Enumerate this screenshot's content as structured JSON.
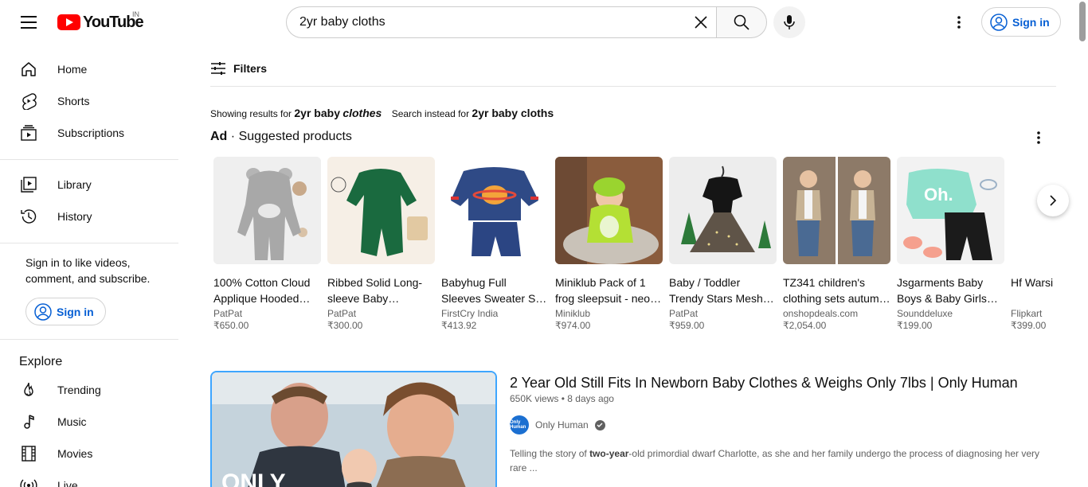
{
  "header": {
    "logo_text": "YouTube",
    "country": "IN",
    "search_value": "2yr baby cloths",
    "signin_label": "Sign in"
  },
  "sidebar": {
    "items": [
      {
        "label": "Home",
        "icon": "home-icon"
      },
      {
        "label": "Shorts",
        "icon": "shorts-icon"
      },
      {
        "label": "Subscriptions",
        "icon": "subscriptions-icon"
      },
      {
        "label": "Library",
        "icon": "library-icon"
      },
      {
        "label": "History",
        "icon": "history-icon"
      }
    ],
    "signin_prompt": "Sign in to like videos, comment, and subscribe.",
    "signin_label": "Sign in",
    "explore_title": "Explore",
    "explore_items": [
      {
        "label": "Trending",
        "icon": "trending-icon"
      },
      {
        "label": "Music",
        "icon": "music-icon"
      },
      {
        "label": "Movies",
        "icon": "movies-icon"
      },
      {
        "label": "Live",
        "icon": "live-icon"
      }
    ]
  },
  "main": {
    "filters_label": "Filters",
    "showing_prefix": "Showing results for",
    "showing_query_a": "2yr baby",
    "showing_query_b": "clothes",
    "instead_prefix": "Search instead for",
    "instead_query": "2yr baby cloths",
    "ad_label": "Ad",
    "ad_dot": "·",
    "ad_title": "Suggested products",
    "products": [
      {
        "name": "100% Cotton Cloud Applique Hooded…",
        "seller": "PatPat",
        "price": "₹650.00"
      },
      {
        "name": "Ribbed Solid Long-sleeve Baby…",
        "seller": "PatPat",
        "price": "₹300.00"
      },
      {
        "name": "Babyhug Full Sleeves Sweater Set Planet …",
        "seller": "FirstCry India",
        "price": "₹413.92"
      },
      {
        "name": "Miniklub Pack of 1 frog sleepsuit - neo…",
        "seller": "Miniklub",
        "price": "₹974.00"
      },
      {
        "name": "Baby / Toddler Trendy Stars Mesh…",
        "seller": "PatPat",
        "price": "₹959.00"
      },
      {
        "name": "TZ341 children's clothing sets autum…",
        "seller": "onshopdeals.com",
        "price": "₹2,054.00"
      },
      {
        "name": "Jsgarments Baby Boys & Baby Girls…",
        "seller": "Sounddeluxe",
        "price": "₹199.00"
      },
      {
        "name": "Hf Warsi Baby Girls",
        "seller": "Flipkart",
        "price": "₹399.00"
      }
    ],
    "video": {
      "title": "2 Year Old Still Fits In Newborn Baby Clothes & Weighs Only 7lbs | Only Human",
      "views": "650K views",
      "sep": "•",
      "age": "8 days ago",
      "channel": "Only Human",
      "avatar_text": "Only Human",
      "desc_a": "Telling the story of ",
      "desc_b": "two-year",
      "desc_c": "-old primordial dwarf Charlotte, as she and her family undergo the process of diagnosing her very rare ...",
      "thumb_text": "ONLY"
    }
  },
  "colors": {
    "accent": "#065fd4",
    "brand": "#ff0000"
  }
}
